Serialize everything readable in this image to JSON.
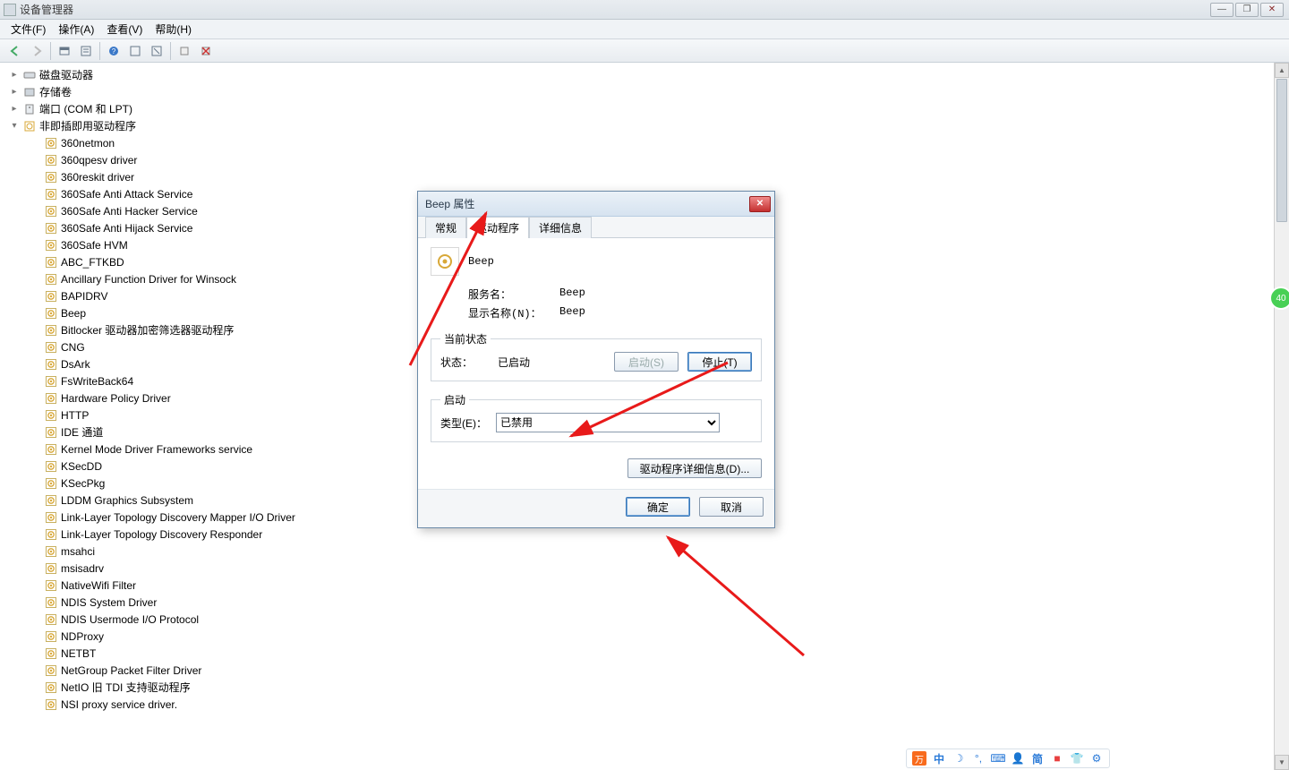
{
  "titlebar": {
    "title": "设备管理器"
  },
  "menubar": {
    "file": "文件(F)",
    "action": "操作(A)",
    "view": "查看(V)",
    "help": "帮助(H)"
  },
  "tree": {
    "categories": [
      {
        "label": "磁盘驱动器",
        "expanded": false
      },
      {
        "label": "存储卷",
        "expanded": false
      },
      {
        "label": "端口 (COM 和 LPT)",
        "expanded": false
      },
      {
        "label": "非即插即用驱动程序",
        "expanded": true,
        "children": [
          "360netmon",
          "360qpesv driver",
          "360reskit driver",
          "360Safe Anti Attack Service",
          "360Safe Anti Hacker Service",
          "360Safe Anti Hijack Service",
          "360Safe HVM",
          "ABC_FTKBD",
          "Ancillary Function Driver for Winsock",
          "BAPIDRV",
          "Beep",
          "Bitlocker 驱动器加密筛选器驱动程序",
          "CNG",
          "DsArk",
          "FsWriteBack64",
          "Hardware Policy Driver",
          "HTTP",
          "IDE 通道",
          "Kernel Mode Driver Frameworks service",
          "KSecDD",
          "KSecPkg",
          "LDDM Graphics Subsystem",
          "Link-Layer Topology Discovery Mapper I/O Driver",
          "Link-Layer Topology Discovery Responder",
          "msahci",
          "msisadrv",
          "NativeWifi Filter",
          "NDIS System Driver",
          "NDIS Usermode I/O Protocol",
          "NDProxy",
          "NETBT",
          "NetGroup Packet Filter Driver",
          "NetIO 旧 TDI 支持驱动程序",
          "NSI proxy service driver."
        ]
      }
    ]
  },
  "dialog": {
    "title": "Beep 属性",
    "tabs": {
      "general": "常规",
      "driver": "驱动程序",
      "details": "详细信息"
    },
    "header_label": "Beep",
    "service_name_label": "服务名：",
    "service_name_value": "Beep",
    "display_name_label": "显示名称(N)：",
    "display_name_value": "Beep",
    "status_group": "当前状态",
    "status_label": "状态：",
    "status_value": "已启动",
    "start_btn": "启动(S)",
    "stop_btn": "停止(T)",
    "startup_group": "启动",
    "type_label": "类型(E)：",
    "type_value": "已禁用",
    "details_btn": "驱动程序详细信息(D)...",
    "ok": "确定",
    "cancel": "取消"
  },
  "tray": {
    "ime": "中",
    "simp": "简"
  },
  "side_badge": "40"
}
